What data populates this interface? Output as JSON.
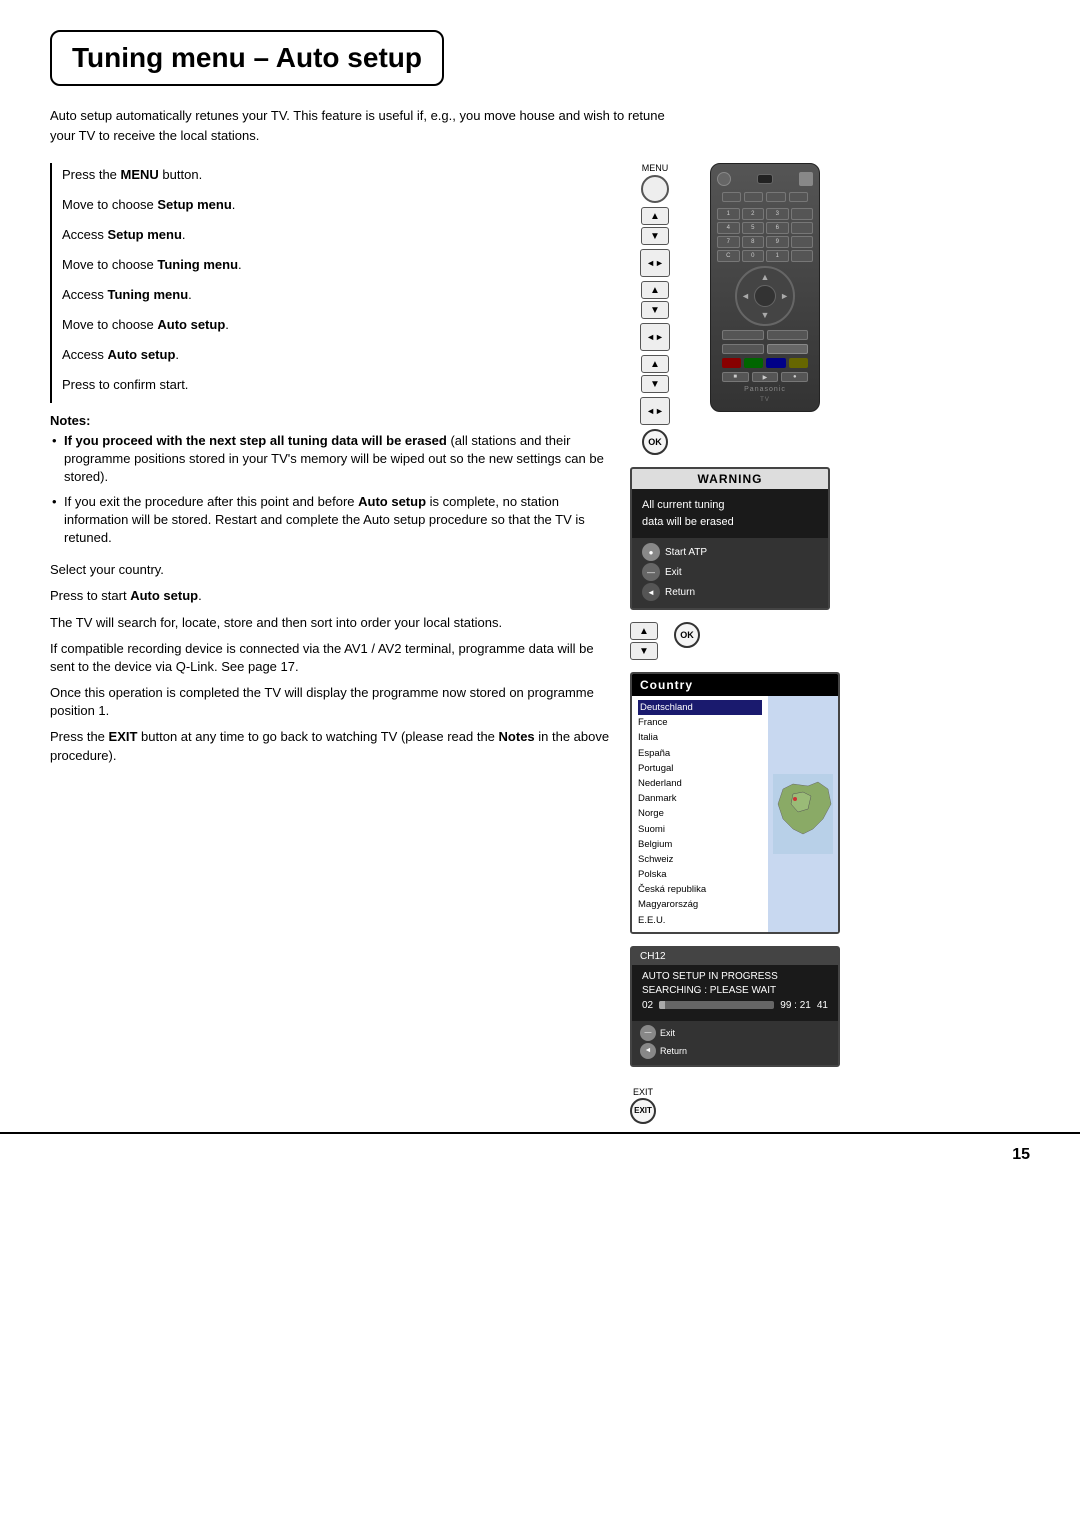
{
  "page": {
    "title": "Tuning menu – Auto setup",
    "page_number": "15"
  },
  "intro": {
    "text": "Auto setup automatically retunes your TV. This feature is useful if, e.g., you move house and wish to retune your TV to receive the local stations."
  },
  "steps": [
    {
      "text": "Press the ",
      "bold": "MENU",
      "rest": " button."
    },
    {
      "text": "Move to choose ",
      "bold": "Setup menu",
      "rest": "."
    },
    {
      "text": "Access ",
      "bold": "Setup menu",
      "rest": "."
    },
    {
      "text": "Move to choose ",
      "bold": "Tuning menu",
      "rest": "."
    },
    {
      "text": "Access ",
      "bold": "Tuning menu",
      "rest": "."
    },
    {
      "text": "Move to choose ",
      "bold": "Auto setup",
      "rest": "."
    },
    {
      "text": "Access ",
      "bold": "Auto setup",
      "rest": "."
    },
    {
      "text": "Press to confirm start.",
      "bold": "",
      "rest": ""
    }
  ],
  "notes": {
    "title": "Notes:",
    "items": [
      "If you proceed with the next step all tuning data will be erased (all stations and their programme positions stored in your TV's memory will be wiped out so the new settings can be stored).",
      "If you exit the procedure after this point and before Auto setup is complete, no station information will be stored. Restart and complete the Auto setup procedure so that the TV is retuned."
    ]
  },
  "lower_steps": [
    {
      "text": "Select your country."
    },
    {
      "text": "Press to start ",
      "bold": "Auto setup",
      "rest": "."
    },
    {
      "text": "The TV will search for, locate, store and then sort into order your local stations."
    },
    {
      "text": "If compatible recording device is connected via the AV1 / AV2 terminal, programme data will be sent to the device via Q-Link. See page 17."
    },
    {
      "text": "Once this operation is completed the TV will display the programme now stored on programme position 1."
    },
    {
      "text": "Press the ",
      "bold": "EXIT",
      "bold2": " button at any time to go back to watching TV (please read the ",
      "bold3": "Notes",
      "rest": " in the above procedure)."
    }
  ],
  "warning_screen": {
    "header": "WARNING",
    "line1": "All  current  tuning",
    "line2": "data  will  be  erased",
    "footer_start_atp": "Start ATP",
    "footer_exit": "Exit",
    "footer_return": "Return"
  },
  "country_screen": {
    "header": "Country",
    "countries": [
      "Deutschland",
      "France",
      "Italia",
      "España",
      "Portugal",
      "Nederland",
      "Danmark",
      "Norge",
      "Suomi",
      "Belgium",
      "Schweiz",
      "Polska",
      "Česká republika",
      "Magyarország",
      "E.E.U."
    ],
    "selected": "Deutschland"
  },
  "progress_screen": {
    "channel": "CH12",
    "line1": "AUTO  SETUP  IN  PROGRESS",
    "line2": "SEARCHING :   PLEASE  WAIT",
    "val1": "02",
    "val2": "99 : 21",
    "val3": "41",
    "footer_exit": "Exit",
    "footer_return": "Return"
  },
  "icons": {
    "menu_label": "MENU",
    "ok_label": "OK",
    "exit_label": "EXIT"
  }
}
